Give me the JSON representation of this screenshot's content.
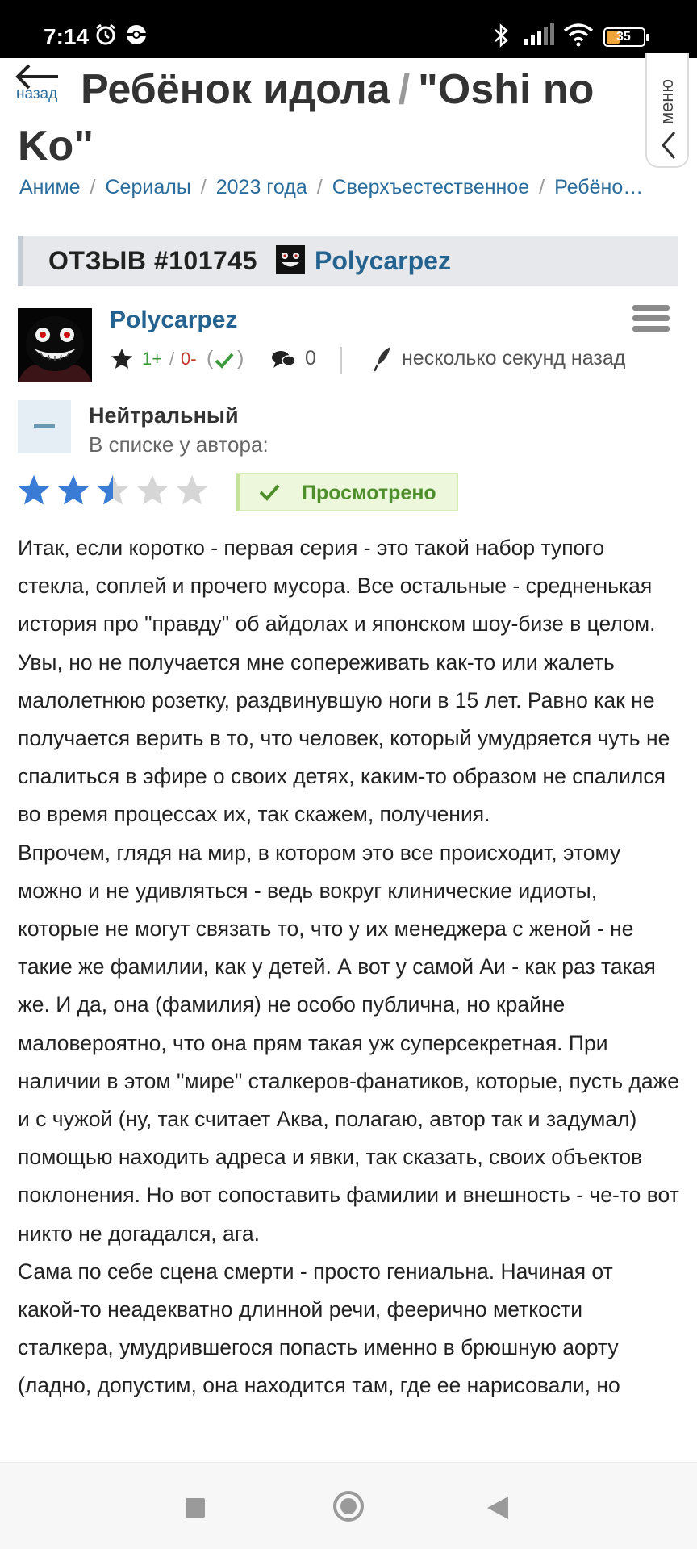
{
  "status_bar": {
    "time": "7:14",
    "battery": "35",
    "icons": [
      "alarm-icon",
      "app-icon",
      "bluetooth-icon",
      "signal-icon",
      "wifi-icon",
      "battery-icon"
    ]
  },
  "header": {
    "back_label": "назад",
    "title_part1": "Ребёнок идола",
    "title_sep": "/",
    "title_part2": "\"Oshi no Ko\"",
    "menu_label": "меню"
  },
  "breadcrumb": [
    "Аниме",
    "Сериалы",
    "2023 года",
    "Сверхъестественное",
    "Ребёно…"
  ],
  "breadcrumb_sep": "/",
  "review": {
    "id_label": "ОТЗЫВ #101745",
    "username": "Polycarpez"
  },
  "author": {
    "name": "Polycarpez",
    "plus": "1+",
    "slash": "/",
    "minus": "0-",
    "paren_open": "(",
    "paren_close": ")",
    "comments": "0",
    "time": "несколько секунд назад"
  },
  "opinion": {
    "label": "Нейтральный",
    "in_list": "В списке у автора:",
    "rating_stars": 2.5,
    "rating_max": 5,
    "status": "Просмотрено"
  },
  "colors": {
    "link": "#24628f",
    "star_filled": "#3a7bd5",
    "star_empty": "#d6d6d6",
    "watched_bg": "#edf7dc",
    "watched_text": "#4e8e2b"
  },
  "content": [
    "Итак, если коротко - первая серия - это такой набор тупого стекла, соплей и прочего мусора. Все остальные - средненькая история про \"правду\" об айдолах и японском шоу-бизе в целом.",
    "Увы, но не получается мне сопереживать как-то или жалеть малолетнюю розетку, раздвинувшую ноги в 15 лет. Равно как не получается верить в то, что человек, который умудряется чуть не спалиться в эфире о своих детях, каким-то образом не спалился во время процессах их, так скажем, получения.",
    "Впрочем, глядя на мир, в котором это все происходит, этому можно и не удивляться - ведь вокруг клинические идиоты, которые не могут связать то, что у их менеджера с женой - не такие же фамилии, как у детей. А вот у самой Аи - как раз такая же. И да, она (фамилия) не особо публична, но крайне маловероятно, что она прям такая уж суперсекретная. При наличии в этом \"мире\" сталкеров-фанатиков, которые, пусть даже и с чужой (ну, так считает Аква, полагаю, автор так и задумал) помощью находить адреса и явки, так сказать, своих объектов поклонения. Но вот сопоставить фамилии и внешность - че-то вот никто не догадался, ага.",
    "Сама по себе сцена смерти - просто гениальна. Начиная от какой-то неадекватно длинной речи, феерично меткости сталкера, умудрившегося попасть именно в брюшную аорту (ладно, допустим, она находится там, где ее нарисовали, но"
  ]
}
